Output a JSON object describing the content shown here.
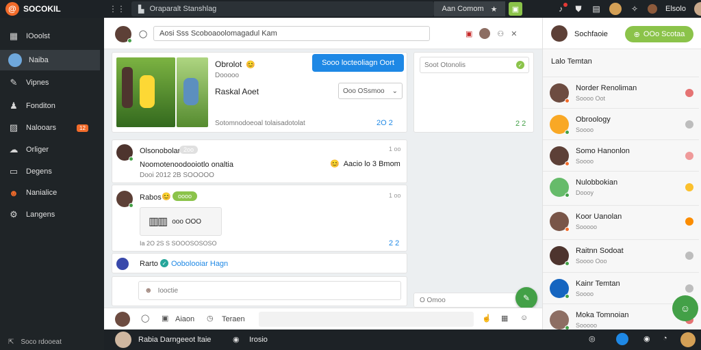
{
  "app": {
    "name": "SOCOKIL",
    "logo_letter": "@"
  },
  "topbar": {
    "search_text": "Oraparalt Stanshlag",
    "pill_text": "Aan Comom",
    "pill_icon": "star-icon",
    "right": {
      "user_name": "Elsolo"
    }
  },
  "sidebar": {
    "items": [
      {
        "label": "IOoolst",
        "icon": "layout-icon"
      },
      {
        "label": "Naiba",
        "icon": "avatar-icon",
        "active": true
      },
      {
        "label": "Vipnes",
        "icon": "pen-icon"
      },
      {
        "label": "Fonditon",
        "icon": "person-icon"
      },
      {
        "label": "Nalooars",
        "icon": "image-icon",
        "badge": "12"
      },
      {
        "label": "Orliger",
        "icon": "cloud-icon"
      },
      {
        "label": "Degens",
        "icon": "chat-icon"
      },
      {
        "label": "Nanialice",
        "icon": "users-icon"
      },
      {
        "label": "Langens",
        "icon": "gear-icon"
      }
    ],
    "footer": "Soco rdooeat"
  },
  "main": {
    "search_placeholder": "Aosi  Sss  Scoboaoolomagadul  Kam",
    "post1": {
      "author": "Obrolot",
      "sub": "Dooooo",
      "title": "Raskal Aoet",
      "tooltip": "Sooo locteoliagn Oort",
      "select_label": "Ooo OSsmoo",
      "footer": "Sotomnodoeoal  tolaisadotolat",
      "actions": "2O 2"
    },
    "side_box": {
      "title": "Soot Otonolis",
      "actions": "2 2"
    },
    "post2": {
      "author": "Olsonobolar",
      "tag": "2oo",
      "time": "1 oo",
      "text": "Noomotenoodooiotlo onaltia",
      "meta": "Dooi  2012  2B  SOOOOO",
      "reaction": "Aacio  lo  3  Bmom"
    },
    "post3": {
      "author": "Rabos",
      "tag": "oooo",
      "time": "1 oo",
      "file": "ooo  OOO",
      "meta": "Ia  2O  2S  S  SOOOSOSOSO",
      "actions": "2 2"
    },
    "post4": {
      "author": "Rarto",
      "link": "Oobolooiar Hagn"
    },
    "reply_placeholder": "Iooctie",
    "side_box2": {
      "text": "O  Omoo"
    },
    "composer": {
      "a": "Aiaon",
      "b": "Teraen"
    }
  },
  "right": {
    "header_name": "Sochfaoie",
    "button_label": "OOo  Scotaa",
    "subtitle": "Lalo Temtan",
    "contacts": [
      {
        "name": "Norder  Renoliman",
        "status": "Soooo  Oot",
        "color": "#e57373",
        "online": "#f26b2a"
      },
      {
        "name": "Obroology",
        "status": "Soooo",
        "color": "#bdbdbd",
        "online": "#43a047"
      },
      {
        "name": "Somo Hanonlon",
        "status": "Soooo",
        "color": "#ef9a9a",
        "online": "#f26b2a"
      },
      {
        "name": "Nulobbokian",
        "status": "Doooy",
        "color": "#fbc02d",
        "online": "#43a047"
      },
      {
        "name": "Koor  Uanolan",
        "status": "Sooooo",
        "color": "#fb8c00",
        "online": "#f26b2a"
      },
      {
        "name": "Raitnn  Sodoat",
        "status": "Soooo  Ooo",
        "color": "#bdbdbd",
        "online": "#43a047"
      },
      {
        "name": "Kainr  Temtan",
        "status": "Soooo",
        "color": "#bdbdbd",
        "online": "#43a047"
      },
      {
        "name": "Moka  Tomnoian",
        "status": "Sooooo",
        "color": "#e57373",
        "online": "#43a047"
      }
    ]
  },
  "bottombar": {
    "user": "Rabia  Darngeeot  ltaie",
    "item": "Irosio"
  },
  "colors": {
    "accent": "#f26b2a",
    "green": "#8bc34a",
    "blue": "#1e88e5",
    "dark": "#1d2226"
  }
}
